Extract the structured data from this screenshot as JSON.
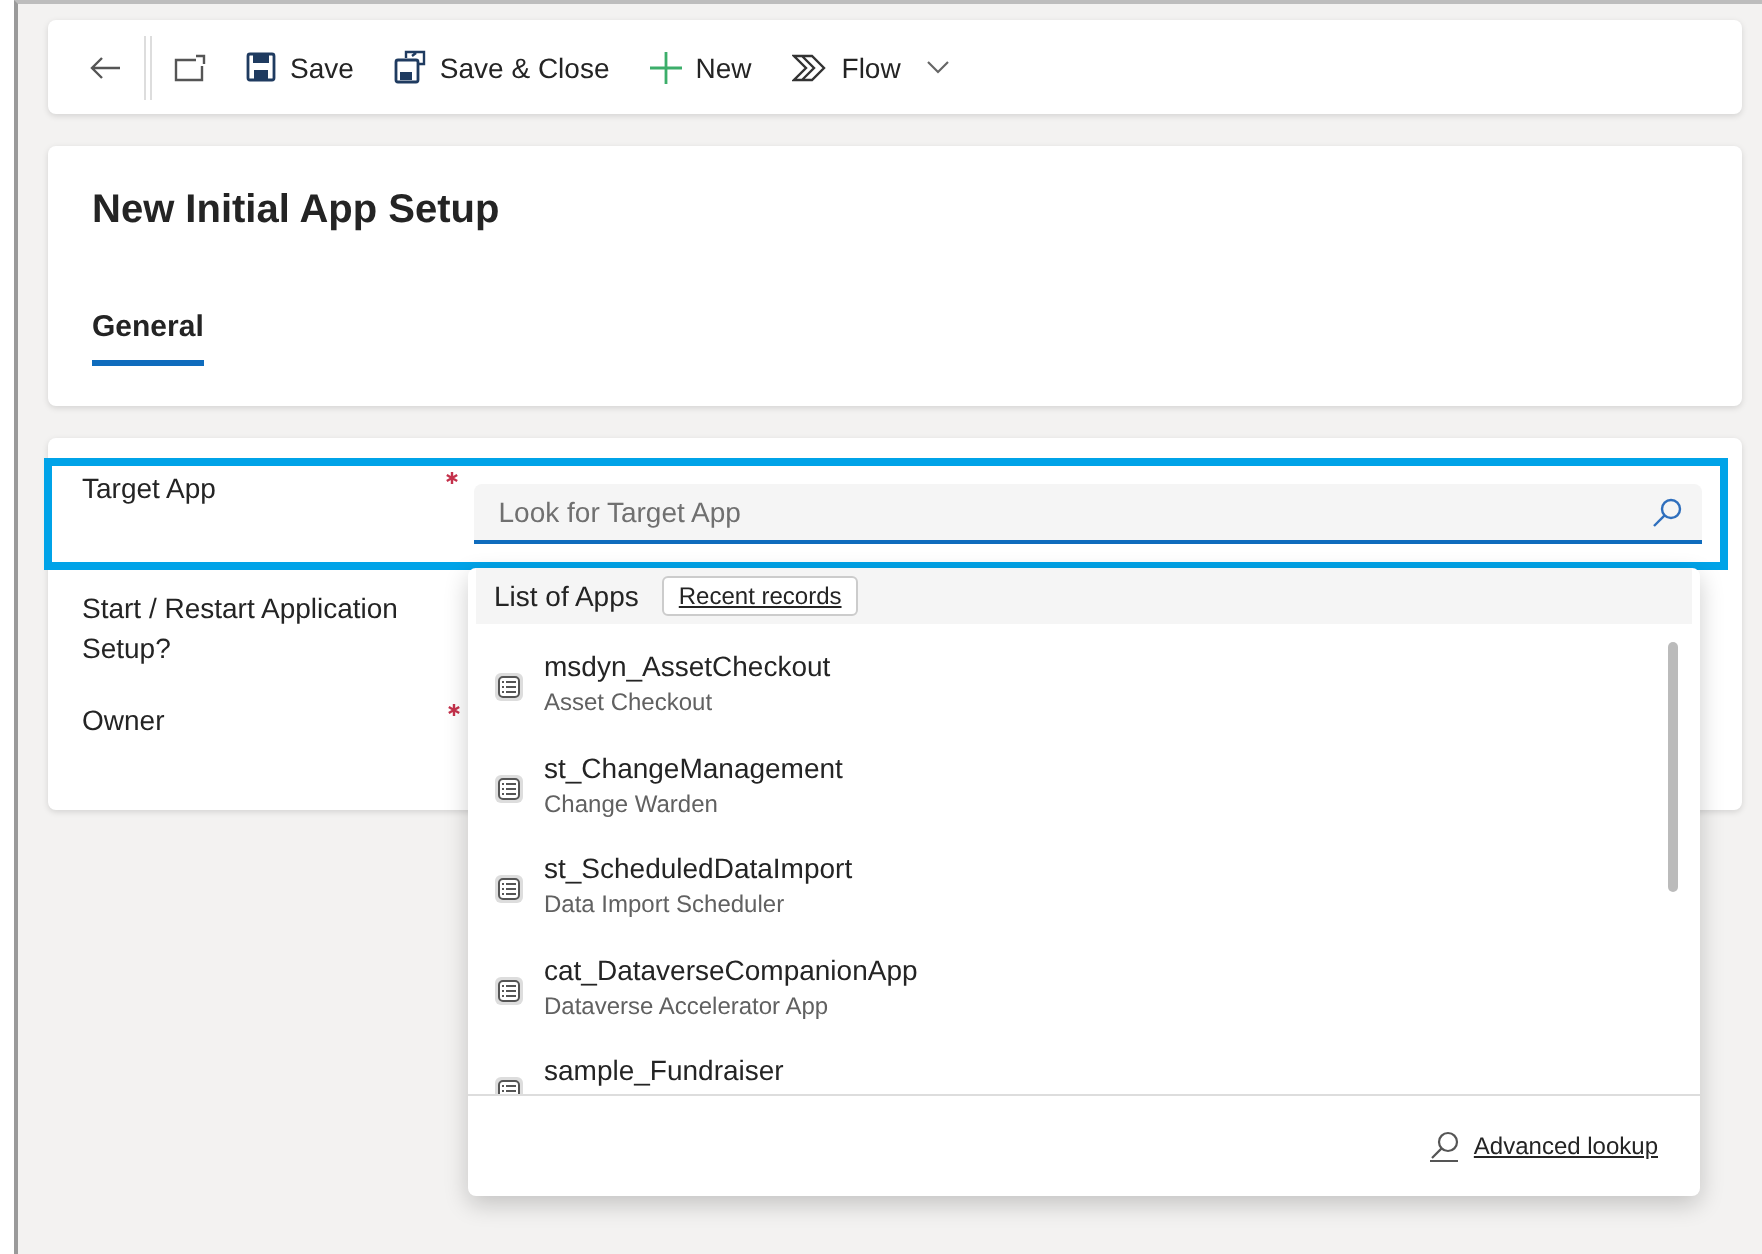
{
  "toolbar": [
    {
      "kind": "back"
    },
    {
      "kind": "popout"
    },
    {
      "kind": "save",
      "label": "Save"
    },
    {
      "kind": "save-close",
      "label": "Save & Close"
    },
    {
      "kind": "new",
      "label": "New"
    },
    {
      "kind": "flow",
      "label": "Flow"
    }
  ],
  "form": {
    "title": "New Initial App Setup",
    "tabs": [
      {
        "label": "General",
        "selected": true
      }
    ]
  },
  "fields": [
    {
      "label": "Target App",
      "required": true
    },
    {
      "label": "Start / Restart Application Setup?",
      "required": false
    },
    {
      "label": "Owner",
      "required": true
    }
  ],
  "lookup": {
    "placeholder": "Look for Target App",
    "list_title": "List of Apps",
    "recent_button": "Recent records",
    "items": [
      {
        "name": "msdyn_AssetCheckout",
        "subtitle": "Asset Checkout"
      },
      {
        "name": "st_ChangeManagement",
        "subtitle": "Change Warden"
      },
      {
        "name": "st_ScheduledDataImport",
        "subtitle": "Data Import Scheduler"
      },
      {
        "name": "cat_DataverseCompanionApp",
        "subtitle": "Dataverse Accelerator App"
      },
      {
        "name": "sample_Fundraiser"
      }
    ],
    "advanced_link": "Advanced lookup"
  }
}
